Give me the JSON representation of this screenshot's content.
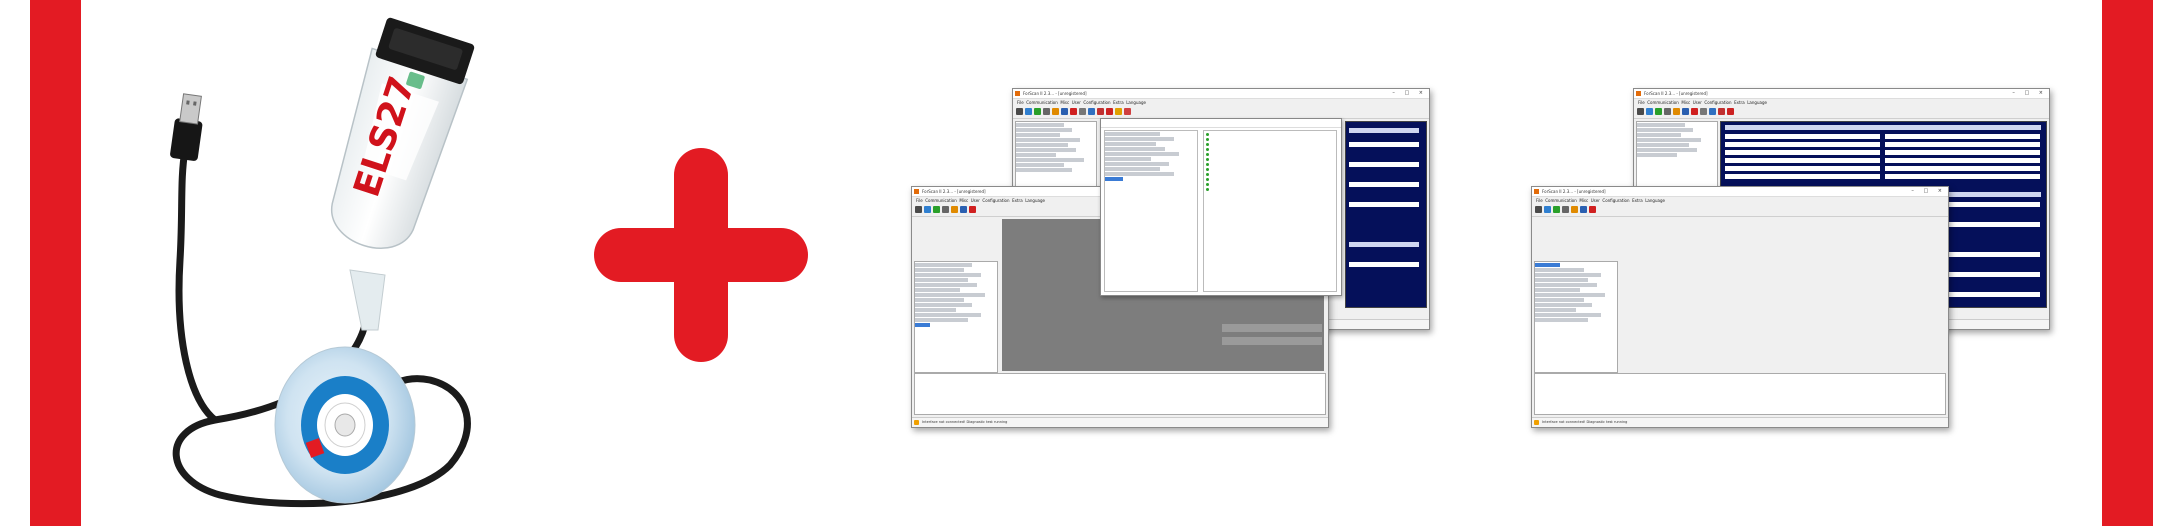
{
  "product": {
    "adapter_label": "ELS27"
  },
  "software": {
    "window_title": "ForScan II 2.3... - [unregistered]",
    "menu": [
      "File",
      "Communication",
      "Misc",
      "User",
      "Configuration",
      "Extra",
      "Language"
    ],
    "status_text": "Interface not connected! Diagnostic test running"
  },
  "colors": {
    "brand_red": "#e31b23",
    "adapter_red": "#d0121b",
    "cd_blue": "#1a7fc8",
    "panel_navy": "#05105a"
  }
}
